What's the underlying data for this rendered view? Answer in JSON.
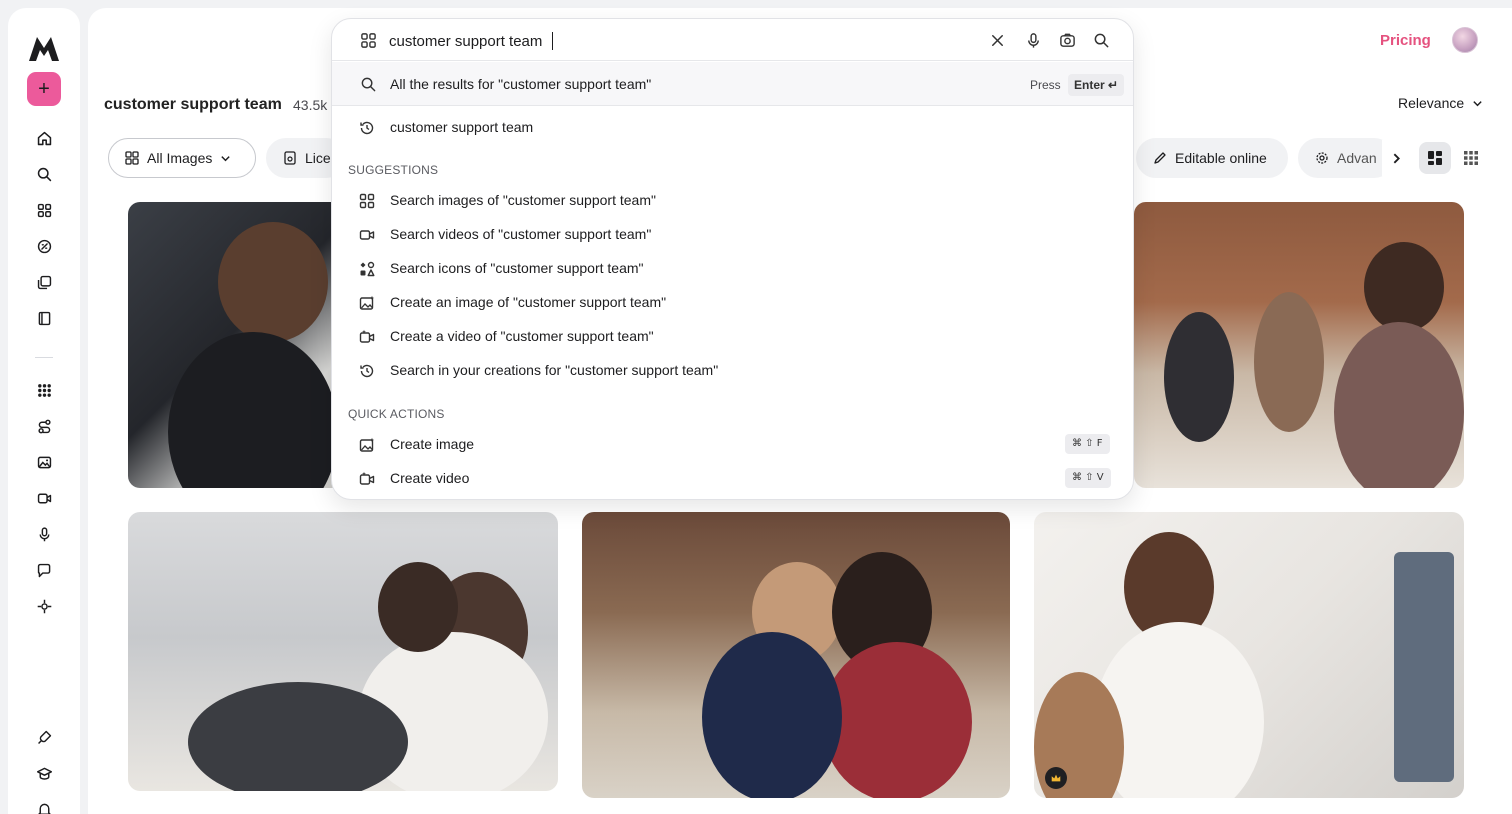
{
  "brand": {
    "logo": "M-logo",
    "accent": "#ec5a9b"
  },
  "header": {
    "pricing_label": "Pricing",
    "avatar": "user-avatar"
  },
  "sidebar": {
    "create_label": "+",
    "icons": [
      "home-icon",
      "search-icon",
      "grid-icon",
      "pricing-icon",
      "stack-icon",
      "book-icon",
      "apps-icon",
      "workflow-icon",
      "image-icon",
      "video-icon",
      "mic-icon",
      "chat-icon",
      "3d-icon",
      "plugin-icon",
      "learn-icon",
      "bell-icon"
    ]
  },
  "results": {
    "title": "customer support team",
    "count": "43.5k",
    "sort_label": "Relevance"
  },
  "filters": {
    "all_images": "All Images",
    "license": "Licen",
    "editable": "Editable online",
    "advanced": "Advan"
  },
  "search": {
    "query": "customer support team",
    "all_results_label": "All the results for \"customer support team\"",
    "press_label": "Press",
    "enter_label": "Enter ↵",
    "history": [
      {
        "icon": "history-icon",
        "label": "customer support team"
      }
    ],
    "suggestions_heading": "SUGGESTIONS",
    "suggestions": [
      {
        "icon": "images-icon",
        "label": "Search images of \"customer support team\""
      },
      {
        "icon": "video-icon",
        "label": "Search videos of \"customer support team\""
      },
      {
        "icon": "icons-icon",
        "label": "Search icons of \"customer support team\""
      },
      {
        "icon": "create-image-icon",
        "label": "Create an image of \"customer support team\""
      },
      {
        "icon": "create-video-icon",
        "label": "Create a video of \"customer support team\""
      },
      {
        "icon": "history-icon",
        "label": "Search in your creations for \"customer support team\""
      }
    ],
    "quick_actions_heading": "QUICK ACTIONS",
    "quick_actions": [
      {
        "icon": "create-image-icon",
        "label": "Create image",
        "shortcut": "⌘ ⇧ F"
      },
      {
        "icon": "create-video-icon",
        "label": "Create video",
        "shortcut": "⌘ ⇧ V"
      }
    ]
  },
  "photos": [
    {
      "name": "photo-call-center-man-headset"
    },
    {
      "name": "photo-call-center-team-brick-office"
    },
    {
      "name": "photo-call-center-world-map"
    },
    {
      "name": "photo-colleagues-pointing-screen"
    },
    {
      "name": "photo-woman-headset-computer",
      "premium": true
    }
  ]
}
